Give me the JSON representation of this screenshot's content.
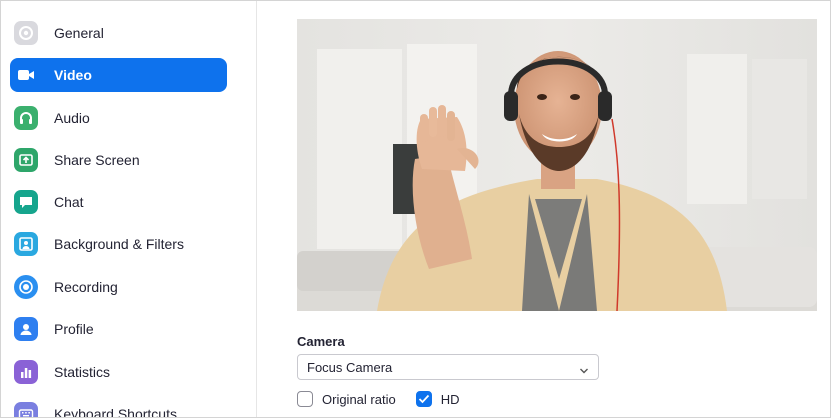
{
  "sidebar": {
    "items": [
      {
        "label": "General",
        "icon": "gear-icon",
        "color": "#d9d9de",
        "active": false
      },
      {
        "label": "Video",
        "icon": "video-camera-icon",
        "color": "#0e72ed",
        "active": true
      },
      {
        "label": "Audio",
        "icon": "headphones-icon",
        "color": "#3bb06e",
        "active": false
      },
      {
        "label": "Share Screen",
        "icon": "share-screen-icon",
        "color": "#2ea66a",
        "active": false
      },
      {
        "label": "Chat",
        "icon": "chat-bubble-icon",
        "color": "#16a58d",
        "active": false
      },
      {
        "label": "Background & Filters",
        "icon": "background-person-icon",
        "color": "#2aa8e0",
        "active": false
      },
      {
        "label": "Recording",
        "icon": "record-icon",
        "color": "#2a8ff0",
        "active": false
      },
      {
        "label": "Profile",
        "icon": "profile-person-icon",
        "color": "#2e7ff0",
        "active": false
      },
      {
        "label": "Statistics",
        "icon": "bar-chart-icon",
        "color": "#8a62d6",
        "active": false
      },
      {
        "label": "Keyboard Shortcuts",
        "icon": "keyboard-icon",
        "color": "#7a7fe0",
        "active": false
      }
    ]
  },
  "video": {
    "camera_label": "Camera",
    "camera_selected": "Focus Camera",
    "original_ratio_label": "Original ratio",
    "original_ratio_checked": false,
    "hd_label": "HD",
    "hd_checked": true
  },
  "colors": {
    "accent": "#0e72ed"
  }
}
